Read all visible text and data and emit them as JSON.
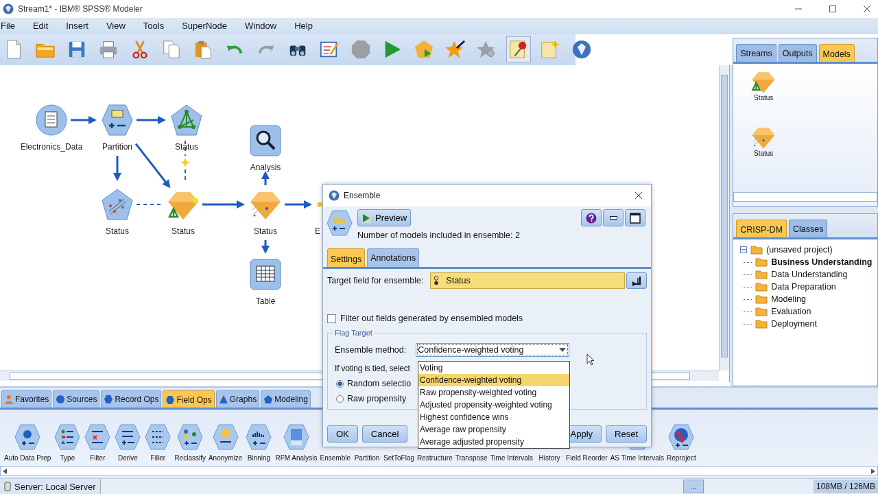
{
  "window": {
    "title": "Stream1* - IBM® SPSS® Modeler"
  },
  "menu": [
    "File",
    "Edit",
    "Insert",
    "View",
    "Tools",
    "SuperNode",
    "Window",
    "Help"
  ],
  "toolbar": [
    {
      "kind": "new",
      "disabled": false,
      "on": false
    },
    {
      "kind": "open",
      "disabled": false,
      "on": false
    },
    {
      "kind": "save",
      "disabled": false,
      "on": false
    },
    {
      "kind": "print",
      "disabled": false,
      "on": false
    },
    {
      "kind": "cut",
      "disabled": false,
      "on": false
    },
    {
      "kind": "copy",
      "disabled": false,
      "on": false
    },
    {
      "kind": "paste",
      "disabled": false,
      "on": false
    },
    {
      "kind": "undo",
      "disabled": false,
      "on": false
    },
    {
      "kind": "redo",
      "disabled": true,
      "on": false
    },
    {
      "kind": "find",
      "disabled": false,
      "on": false
    },
    {
      "kind": "edit",
      "disabled": false,
      "on": false
    },
    {
      "kind": "stop",
      "disabled": true,
      "on": false
    },
    {
      "kind": "run",
      "disabled": false,
      "on": false
    },
    {
      "kind": "run-selection",
      "disabled": false,
      "on": false
    },
    {
      "kind": "star-wand",
      "disabled": false,
      "on": false
    },
    {
      "kind": "star-zoom",
      "disabled": true,
      "on": false
    },
    {
      "kind": "pin",
      "disabled": false,
      "on": true
    },
    {
      "kind": "note",
      "disabled": false,
      "on": false
    },
    {
      "kind": "gem",
      "disabled": false,
      "on": false
    }
  ],
  "stream": {
    "nodes": [
      {
        "label": "Electronics_Data",
        "kind": "source"
      },
      {
        "label": "Partition",
        "kind": "partition"
      },
      {
        "label": "Status",
        "kind": "neural"
      },
      {
        "label": "Status",
        "kind": "svm"
      },
      {
        "label": "Status",
        "kind": "model-neural"
      },
      {
        "label": "Analysis",
        "kind": "analysis"
      },
      {
        "label": "Status",
        "kind": "model-svm"
      },
      {
        "label": "Table",
        "kind": "table"
      },
      {
        "label": "E",
        "kind": "ensemble"
      }
    ],
    "links": [
      {
        "dashed": false
      },
      {
        "dashed": false
      },
      {
        "dashed": false
      },
      {
        "dashed": false
      },
      {
        "dashed": false
      },
      {
        "dashed": false
      },
      {
        "dashed": false
      },
      {
        "dashed": false
      },
      {
        "dashed": true
      },
      {
        "dashed": true
      }
    ]
  },
  "managers": {
    "tabs": [
      {
        "label": "Streams",
        "selected": false
      },
      {
        "label": "Outputs",
        "selected": false
      },
      {
        "label": "Models",
        "selected": true
      }
    ],
    "models": [
      {
        "label": "Status",
        "kind": "neural"
      },
      {
        "label": "Status",
        "kind": "svm"
      }
    ]
  },
  "project": {
    "tabs": [
      {
        "label": "CRISP-DM",
        "selected": true
      },
      {
        "label": "Classes",
        "selected": false
      }
    ],
    "root": {
      "label": "(unsaved project)",
      "expanded": true,
      "children": [
        {
          "label": "Business Understanding",
          "current": true
        },
        {
          "label": "Data Understanding",
          "current": false
        },
        {
          "label": "Data Preparation",
          "current": false
        },
        {
          "label": "Modeling",
          "current": false
        },
        {
          "label": "Evaluation",
          "current": false
        },
        {
          "label": "Deployment",
          "current": false
        }
      ]
    }
  },
  "palette": {
    "tabs": [
      {
        "label": "Favorites",
        "kind": "person",
        "selected": false
      },
      {
        "label": "Sources",
        "kind": "circle",
        "selected": false
      },
      {
        "label": "Record Ops",
        "kind": "hexagon",
        "selected": false
      },
      {
        "label": "Field Ops",
        "kind": "hexagon",
        "selected": true
      },
      {
        "label": "Graphs",
        "kind": "triangle",
        "selected": false
      },
      {
        "label": "Modeling",
        "kind": "pentagon",
        "selected": false
      }
    ],
    "items": [
      {
        "label": "Auto Data Prep",
        "kind": "gear"
      },
      {
        "label": "Type",
        "kind": "type"
      },
      {
        "label": "Filter",
        "kind": "filter"
      },
      {
        "label": "Derive",
        "kind": "derive"
      },
      {
        "label": "Filler",
        "kind": "filler"
      },
      {
        "label": "Reclassify",
        "kind": "reclassify"
      },
      {
        "label": "Anonymize",
        "kind": "anonymize"
      },
      {
        "label": "Binning",
        "kind": "binning"
      },
      {
        "label": "RFM Analysis",
        "kind": "rfm"
      },
      {
        "label": "Ensemble",
        "kind": "covered"
      },
      {
        "label": "Partition",
        "kind": "covered"
      },
      {
        "label": "SetToFlag",
        "kind": "covered"
      },
      {
        "label": "Restructure",
        "kind": "covered"
      },
      {
        "label": "Transpose",
        "kind": "covered"
      },
      {
        "label": "Time Intervals",
        "kind": "covered"
      },
      {
        "label": "History",
        "kind": "covered"
      },
      {
        "label": "Field Reorder",
        "kind": "covered"
      },
      {
        "label": "AS Time Intervals",
        "kind": "clock"
      },
      {
        "label": "Reproject",
        "kind": "globe"
      }
    ]
  },
  "dialog": {
    "title": "Ensemble",
    "preview": "Preview",
    "info": "Number of models included in ensemble: 2",
    "tabs": [
      {
        "label": "Settings",
        "selected": true
      },
      {
        "label": "Annotations",
        "selected": false
      }
    ],
    "target_label": "Target field for ensemble:",
    "target_value": "Status",
    "filter_checkbox": {
      "label": "Filter out fields generated by ensembled models",
      "checked": false
    },
    "group": "Flag Target",
    "method_label": "Ensemble method:",
    "method_value": "Confidence-weighted voting",
    "method_options": [
      {
        "label": "Voting",
        "selected": false
      },
      {
        "label": "Confidence-weighted voting",
        "selected": true
      },
      {
        "label": "Raw propensity-weighted voting",
        "selected": false
      },
      {
        "label": "Adjusted propensity-weighted voting",
        "selected": false
      },
      {
        "label": "Highest confidence wins",
        "selected": false
      },
      {
        "label": "Average raw propensity",
        "selected": false
      },
      {
        "label": "Average adjusted propensity",
        "selected": false
      }
    ],
    "tie_label": "If voting is tied, select",
    "tie_options": [
      {
        "label": "Random selectio",
        "selected": true
      },
      {
        "label": "Raw propensity",
        "selected": false
      }
    ],
    "buttons_left": [
      "OK",
      "Cancel"
    ],
    "buttons_right": [
      "Apply",
      "Reset"
    ]
  },
  "status_bar": {
    "server": "Server: Local Server",
    "more": "...",
    "memory": "108MB / 126MB"
  }
}
